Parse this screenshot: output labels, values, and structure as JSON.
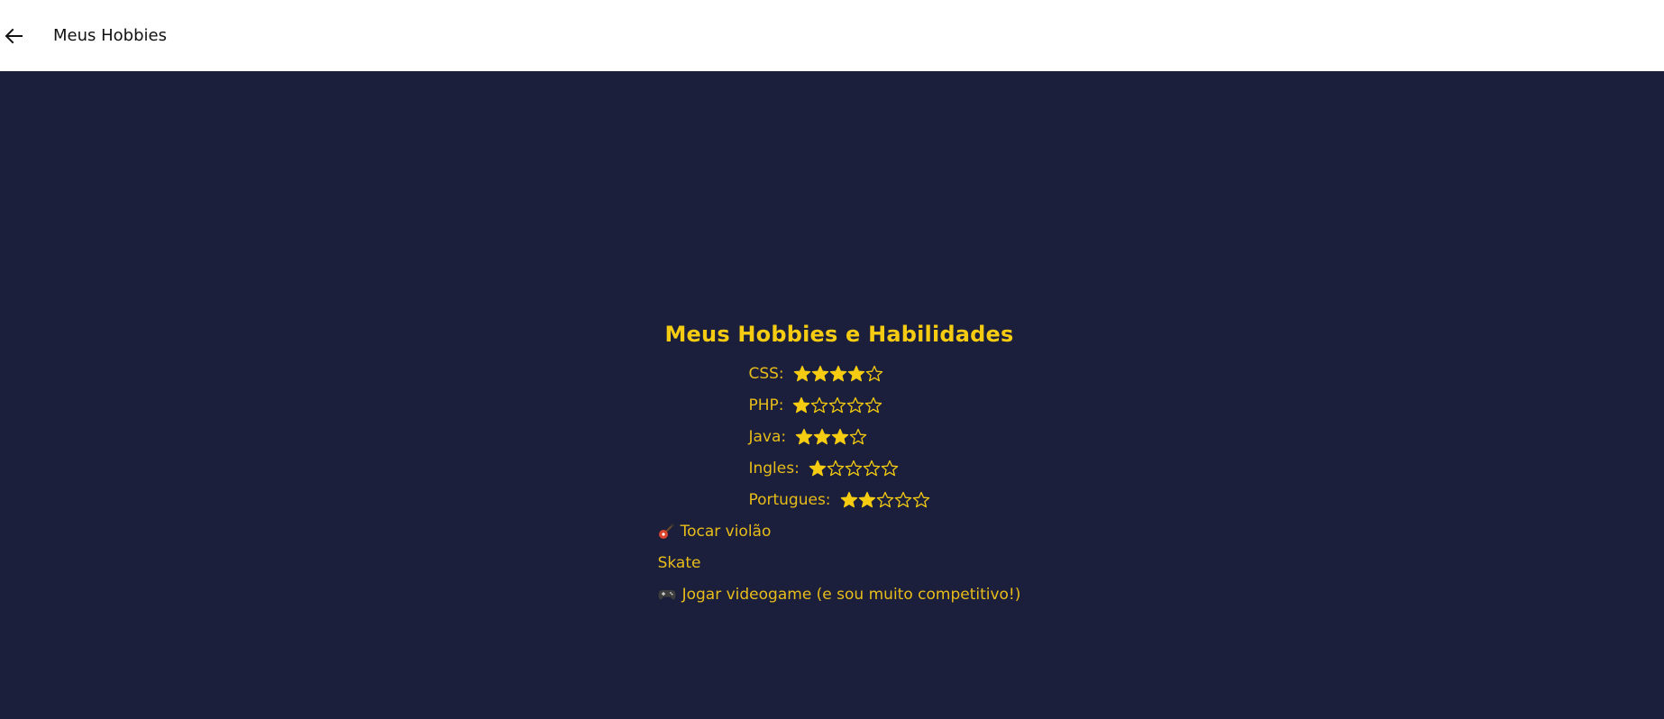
{
  "app_bar": {
    "title": "Meus Hobbies",
    "back_icon": "arrow-left-icon"
  },
  "colors": {
    "background": "#1b1f3b",
    "accent": "#f5cc12",
    "text": "#e8bd1a",
    "app_bar": "#ffffff"
  },
  "content": {
    "heading": "Meus Hobbies e Habilidades",
    "skills": [
      {
        "name": "CSS:",
        "rating": 4,
        "max": 5
      },
      {
        "name": "PHP:",
        "rating": 1,
        "max": 5
      },
      {
        "name": "Java:",
        "rating": 3,
        "max": 4
      },
      {
        "name": "Ingles:",
        "rating": 1,
        "max": 5
      },
      {
        "name": "Portugues:",
        "rating": 2,
        "max": 5
      }
    ],
    "hobbies": [
      {
        "emoji": "guitar-icon",
        "label": "Tocar violão"
      },
      {
        "emoji": "",
        "label": "Skate"
      },
      {
        "emoji": "game-controller-icon",
        "label": "Jogar videogame (e sou muito competitivo!)"
      }
    ]
  }
}
